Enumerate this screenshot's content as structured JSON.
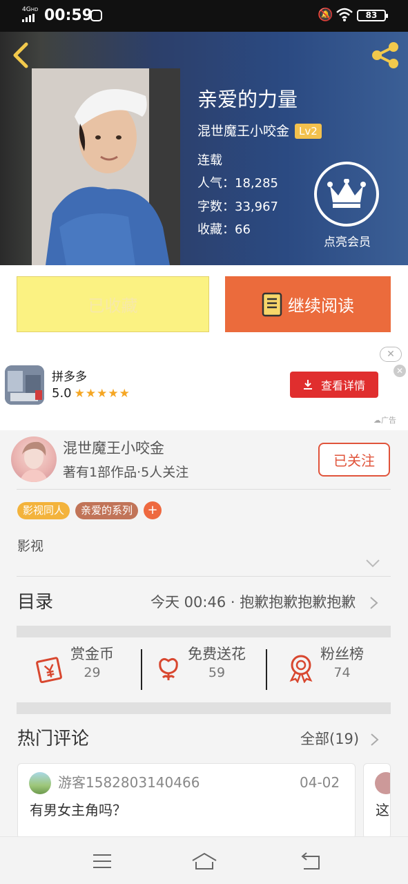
{
  "status_bar": {
    "network": "4G",
    "network_sup": "HD",
    "time": "00:59",
    "battery": "83"
  },
  "book": {
    "title": "亲爱的力量",
    "author": "混世魔王小咬金",
    "level": "Lv2",
    "status": "连载",
    "popularity": "人气：18,285",
    "word_count": "字数：33,967",
    "favorites": "收藏：66",
    "vip_label": "点亮会员"
  },
  "actions": {
    "favorite_label": "已收藏",
    "read_label": "继续阅读"
  },
  "ad": {
    "app_name": "拼多多",
    "rating": "5.0",
    "stars": "★★★★★",
    "cta_label": "查看详情",
    "ad_mark": "广告"
  },
  "author_card": {
    "name": "混世魔王小咬金",
    "subtitle": "著有1部作品·5人关注",
    "follow_label": "已关注"
  },
  "tags": [
    "影视同人",
    "亲爱的系列"
  ],
  "category": "影视",
  "toc": {
    "title": "目录",
    "latest": "今天 00:46 · 抱歉抱歉抱歉抱歉"
  },
  "stats": [
    {
      "label": "赏金币",
      "value": "29"
    },
    {
      "label": "免费送花",
      "value": "59"
    },
    {
      "label": "粉丝榜",
      "value": "74"
    }
  ],
  "comments": {
    "title": "热门评论",
    "all_label": "全部(19)",
    "items": [
      {
        "user": "游客1582803140466",
        "date": "04-02",
        "text": "有男女主角吗？"
      },
      {
        "text": "这"
      }
    ]
  },
  "colors": {
    "accent_orange": "#eb6b3c",
    "favorite_yellow": "#fbf282",
    "follow_red": "#e0533a",
    "ad_red": "#e02e2e",
    "level_gold": "#f3c14d"
  }
}
